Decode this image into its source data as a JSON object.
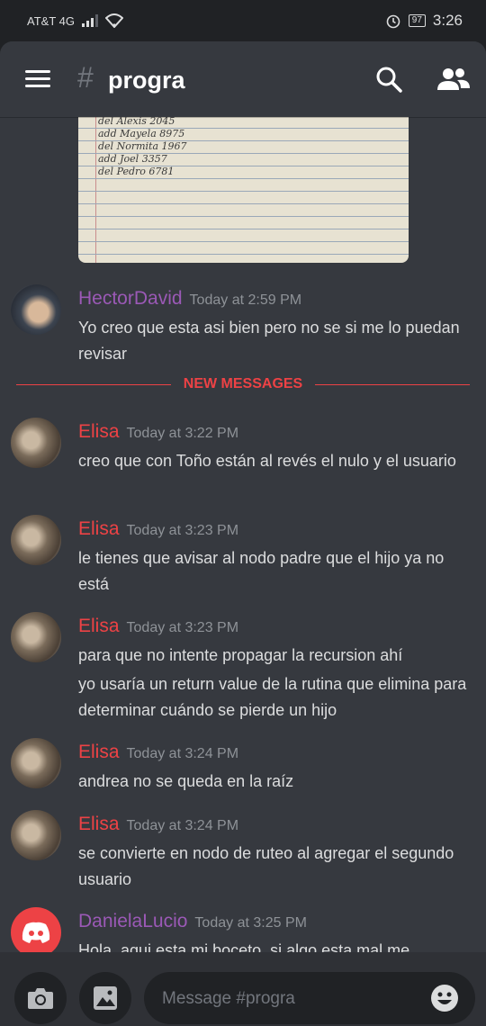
{
  "status_bar": {
    "carrier": "AT&T 4G",
    "battery": "97",
    "time": "3:26"
  },
  "header": {
    "hash": "#",
    "channel": "progra"
  },
  "attachment": {
    "handwriting": [
      "del Alexis 2045",
      "add Mayela 8975",
      "del Normita 1967",
      "add Joel 3357",
      "del Pedro 6781"
    ]
  },
  "messages": [
    {
      "author": "HectorDavid",
      "time": "Today at 2:59 PM",
      "lines": [
        "Yo creo que esta asi bien pero no se si me lo puedan revisar"
      ]
    },
    {
      "author": "Elisa",
      "time": "Today at 3:22 PM",
      "lines": [
        "creo que con Toño están al revés el nulo y el usuario"
      ]
    },
    {
      "author": "Elisa",
      "time": "Today at 3:23 PM",
      "lines": [
        "le tienes que avisar al nodo padre que el hijo ya no está"
      ]
    },
    {
      "author": "Elisa",
      "time": "Today at 3:23 PM",
      "lines": [
        "para que no intente propagar la recursion ahí",
        "yo usaría un return value de la rutina que elimina para determinar cuándo se pierde un hijo"
      ]
    },
    {
      "author": "Elisa",
      "time": "Today at 3:24 PM",
      "lines": [
        "andrea no se queda en la raíz"
      ]
    },
    {
      "author": "Elisa",
      "time": "Today at 3:24 PM",
      "lines": [
        "se convierte en nodo de ruteo al agregar el segundo usuario"
      ]
    },
    {
      "author": "DanielaLucio",
      "time": "Today at 3:25 PM",
      "lines": [
        "Hola, aqui esta mi boceto, si algo esta mal me"
      ]
    }
  ],
  "divider_label": "NEW MESSAGES",
  "input": {
    "placeholder": "Message #progra"
  },
  "colors": {
    "purple_user": "#9b59b6",
    "red_user": "#ed4245",
    "background": "#36393f"
  }
}
